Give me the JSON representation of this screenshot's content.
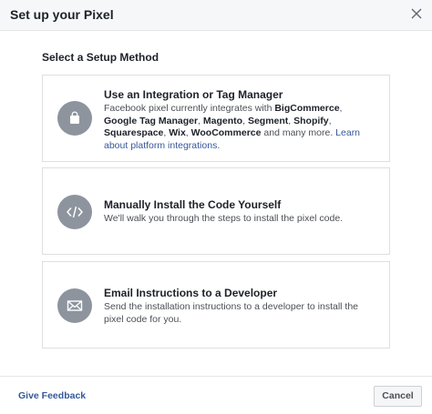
{
  "header": {
    "title": "Set up your Pixel",
    "close_icon": "close-icon"
  },
  "section": {
    "title": "Select a Setup Method"
  },
  "options": [
    {
      "icon": "shopping-bag-icon",
      "title": "Use an Integration or Tag Manager",
      "desc_parts": {
        "p0": "Facebook pixel currently integrates with ",
        "b0": "BigCommerce",
        "p1": ", ",
        "b1": "Google Tag Manager",
        "p2": ", ",
        "b2": "Magento",
        "p3": ", ",
        "b3": "Segment",
        "p4": ", ",
        "b4": "Shopify",
        "p5": ", ",
        "b5": "Squarespace",
        "p6": ", ",
        "b6": "Wix",
        "p7": ", ",
        "b7": "WooCommerce",
        "p8": " and many more. ",
        "link": "Learn about platform integrations",
        "p9": "."
      }
    },
    {
      "icon": "code-icon",
      "title": "Manually Install the Code Yourself",
      "desc": "We'll walk you through the steps to install the pixel code."
    },
    {
      "icon": "envelope-icon",
      "title": "Email Instructions to a Developer",
      "desc": "Send the installation instructions to a developer to install the pixel code for you."
    }
  ],
  "footer": {
    "feedback_label": "Give Feedback",
    "cancel_label": "Cancel"
  },
  "colors": {
    "icon_bg": "#8d949e",
    "link": "#365899",
    "header_bg": "#f6f7f9"
  }
}
